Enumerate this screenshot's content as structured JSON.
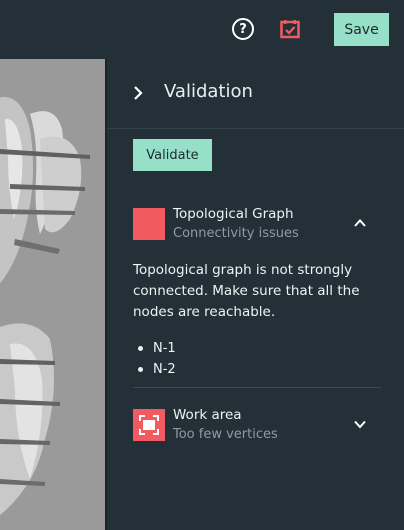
{
  "toolbar": {
    "help_icon": "question-circle-icon",
    "help_glyph": "?",
    "validation_icon": "validation-checkbox-icon",
    "save_label": "Save"
  },
  "panel": {
    "title": "Validation",
    "validate_label": "Validate",
    "issues": [
      {
        "title": "Topological Graph",
        "subtitle": "Connectivity issues",
        "icon": "error-swatch",
        "expanded": true,
        "description": "Topological graph is not strongly connected. Make sure that all the nodes are reachable.",
        "nodes": [
          "N-1",
          "N-2"
        ]
      },
      {
        "title": "Work area",
        "subtitle": "Too few vertices",
        "icon": "work-area-icon",
        "expanded": false
      }
    ]
  },
  "colors": {
    "background": "#233037",
    "accent": "#96e0c7",
    "error": "#f25a62",
    "muted_text": "#8e9ca2"
  }
}
